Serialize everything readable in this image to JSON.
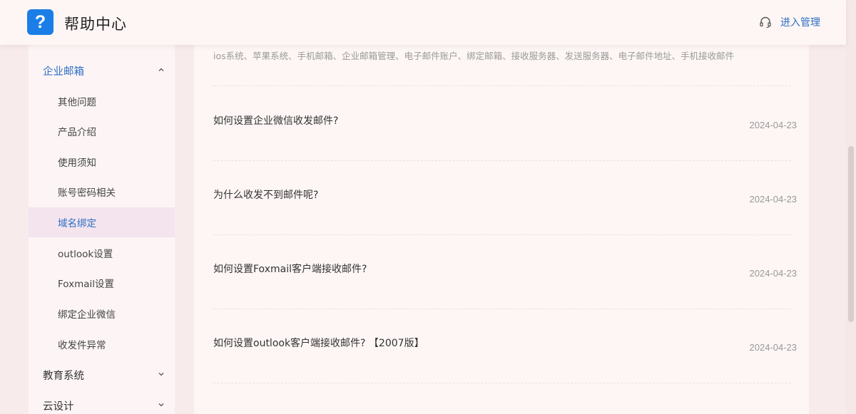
{
  "header": {
    "logo_glyph": "?",
    "title": "帮助中心",
    "admin_label": "进入管理"
  },
  "sidebar": {
    "items": [
      {
        "label": "企业邮箱",
        "type": "parent",
        "expanded": true
      },
      {
        "label": "其他问题",
        "type": "child"
      },
      {
        "label": "产品介绍",
        "type": "child"
      },
      {
        "label": "使用须知",
        "type": "child"
      },
      {
        "label": "账号密码相关",
        "type": "child"
      },
      {
        "label": "域名绑定",
        "type": "child",
        "selected": true
      },
      {
        "label": "outlook设置",
        "type": "child"
      },
      {
        "label": "Foxmail设置",
        "type": "child"
      },
      {
        "label": "绑定企业微信",
        "type": "child"
      },
      {
        "label": "收发件异常",
        "type": "child"
      },
      {
        "label": "教育系统",
        "type": "parent",
        "expanded": false
      },
      {
        "label": "云设计",
        "type": "parent",
        "expanded": false
      }
    ]
  },
  "main": {
    "tags": "ios系统、苹果系统、手机邮箱、企业邮箱管理、电子邮件账户、绑定邮箱、接收服务器、发送服务器、电子邮件地址、手机接收邮件",
    "articles": [
      {
        "title": "如何设置企业微信收发邮件?",
        "date": "2024-04-23"
      },
      {
        "title": "为什么收发不到邮件呢?",
        "date": "2024-04-23"
      },
      {
        "title": "如何设置Foxmail客户端接收邮件?",
        "date": "2024-04-23"
      },
      {
        "title": "如何设置outlook客户端接收邮件? 【2007版】",
        "date": "2024-04-23"
      }
    ]
  },
  "colors": {
    "accent": "#2f6fc4",
    "logo_bg": "#1b7ee6",
    "page_bg": "#f8ebec",
    "panel_bg": "#fdf6f5",
    "selected_bg": "#f3e4ee"
  },
  "icons": {
    "logo": "question-mark-icon",
    "admin": "headset-icon",
    "expanded": "chevron-up-icon",
    "collapsed": "chevron-down-icon"
  }
}
